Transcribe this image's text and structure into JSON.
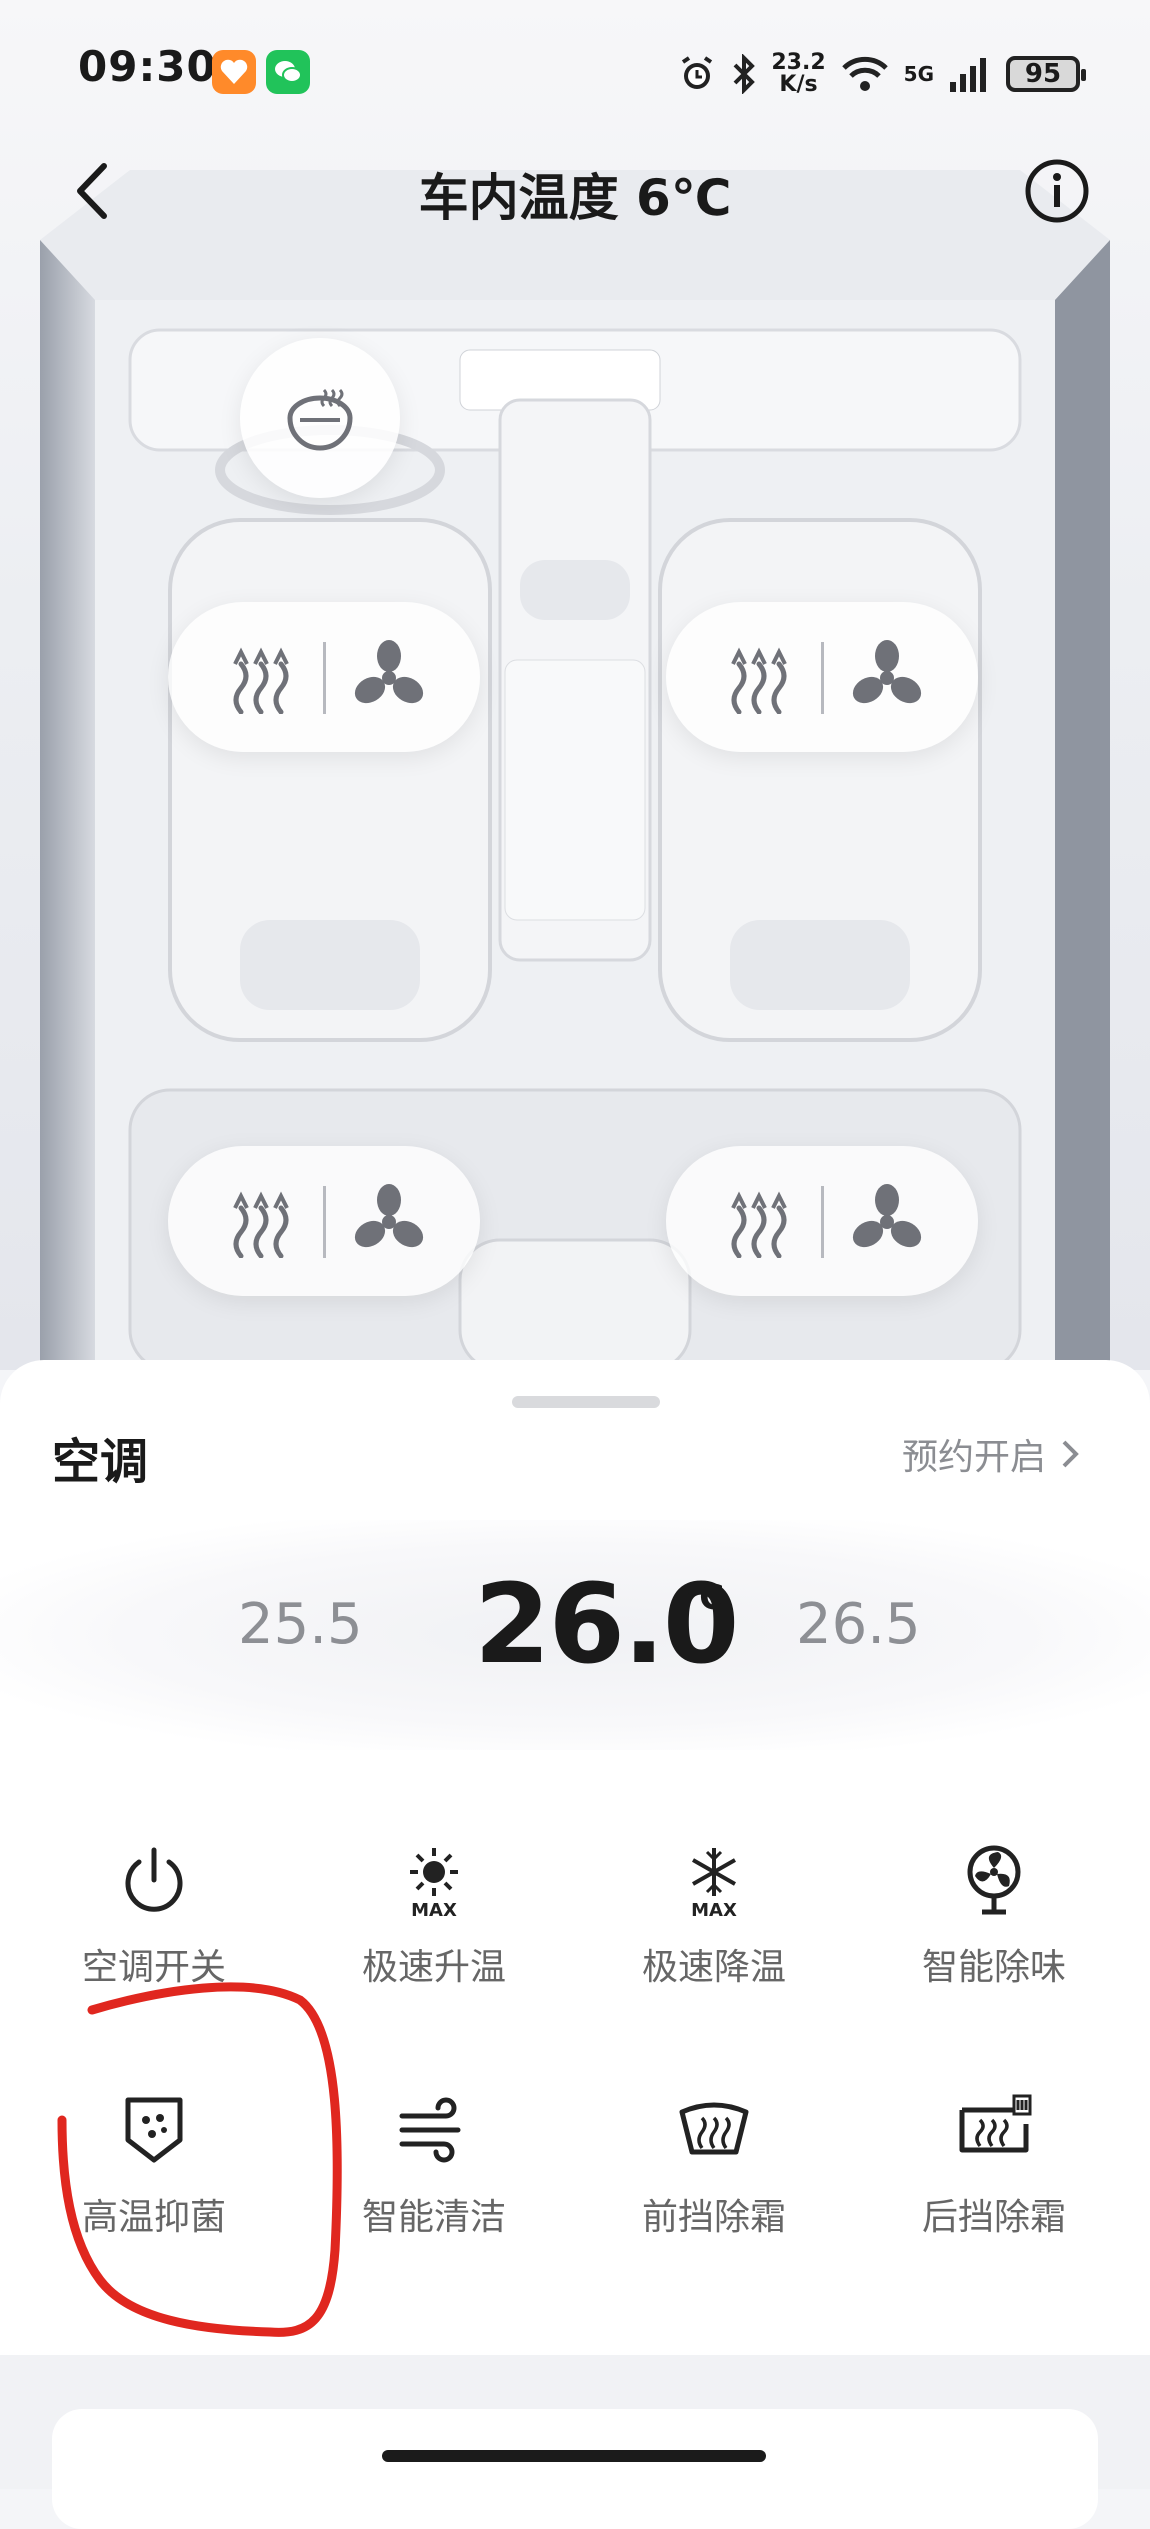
{
  "status_bar": {
    "time": "09:30",
    "net_speed_value": "23.2",
    "net_speed_unit": "K/s",
    "network": "5G",
    "battery": "95"
  },
  "header": {
    "title": "车内温度 6℃"
  },
  "climate": {
    "title": "空调",
    "schedule_label": "预约开启",
    "temp_prev": "25.5",
    "temp_current": "26.0",
    "temp_unit": "℃",
    "temp_next": "26.5",
    "controls": [
      {
        "label": "空调开关",
        "icon": "power-icon"
      },
      {
        "label": "极速升温",
        "icon": "sun-max-icon"
      },
      {
        "label": "极速降温",
        "icon": "snowflake-max-icon"
      },
      {
        "label": "智能除味",
        "icon": "fan-icon"
      },
      {
        "label": "高温抑菌",
        "icon": "shield-dots-icon"
      },
      {
        "label": "智能清洁",
        "icon": "wind-icon"
      },
      {
        "label": "前挡除霜",
        "icon": "front-defrost-icon"
      },
      {
        "label": "后挡除霜",
        "icon": "rear-defrost-icon"
      }
    ]
  },
  "colors": {
    "annotation": "#e0271f",
    "sheet": "#ffffff",
    "background": "#f4f5f8"
  }
}
